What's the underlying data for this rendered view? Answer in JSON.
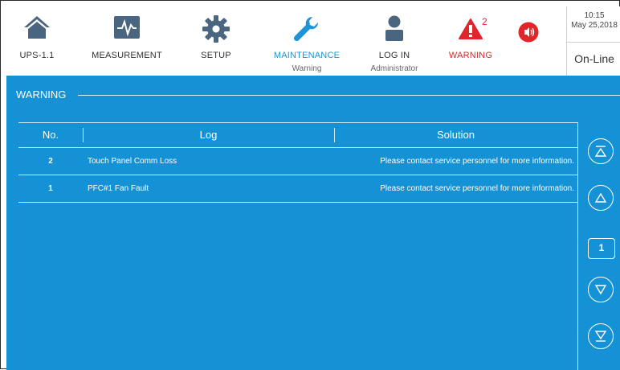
{
  "toolbar": {
    "items": [
      {
        "label": "UPS-1.1",
        "icon": "home-icon"
      },
      {
        "label": "MEASUREMENT",
        "icon": "measurement-icon"
      },
      {
        "label": "SETUP",
        "icon": "gear-icon"
      },
      {
        "label": "MAINTENANCE",
        "sub": "Warning",
        "icon": "wrench-icon"
      },
      {
        "label": "LOG IN",
        "sub": "Administrator",
        "icon": "user-icon"
      },
      {
        "label": "WARNING",
        "badge": "2",
        "icon": "warning-icon"
      },
      {
        "label": "",
        "icon": "speaker-icon"
      }
    ],
    "clock": {
      "time": "10:15",
      "date": "May 25,2018"
    },
    "status": "On-Line"
  },
  "panel": {
    "title": "WARNING",
    "columns": {
      "no": "No.",
      "log": "Log",
      "solution": "Solution"
    },
    "rows": [
      {
        "no": "2",
        "log": "Touch Panel Comm Loss",
        "solution": "Please contact service personnel for more information."
      },
      {
        "no": "1",
        "log": "PFC#1 Fan Fault",
        "solution": "Please contact service personnel for more information."
      }
    ],
    "page": "1"
  },
  "colors": {
    "accent": "#1592d6",
    "alert": "#e0262b",
    "icon_dark": "#4a6580"
  }
}
